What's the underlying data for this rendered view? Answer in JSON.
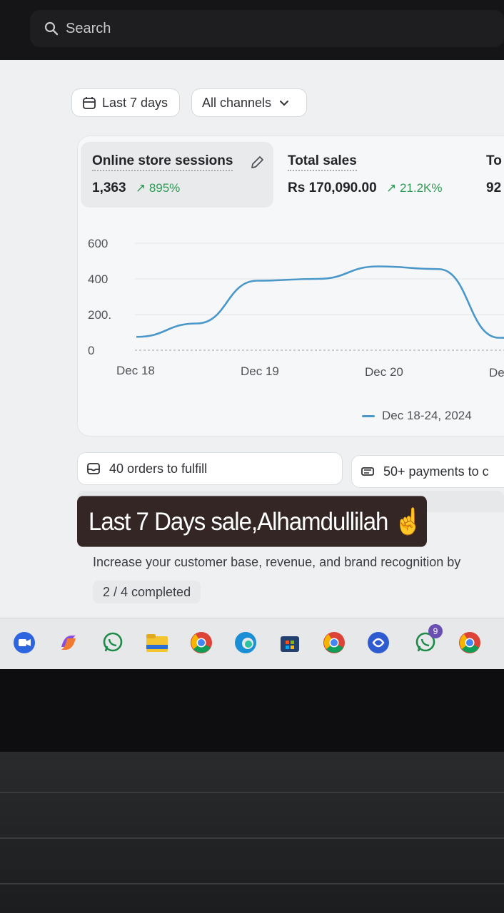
{
  "search": {
    "placeholder": "Search"
  },
  "filters": {
    "date_range": "Last 7 days",
    "channels": "All channels"
  },
  "metrics": [
    {
      "title": "Online store sessions",
      "value": "1,363",
      "change": "895%"
    },
    {
      "title": "Total sales",
      "value": "Rs 170,090.00",
      "change": "21.2K%"
    },
    {
      "title": "To",
      "value": "92"
    }
  ],
  "chart_data": {
    "type": "line",
    "title": "",
    "xlabel": "",
    "ylabel": "",
    "ylim": [
      0,
      600
    ],
    "y_ticks": [
      "600",
      "400",
      "200.",
      "0"
    ],
    "x_ticks": [
      "Dec 18",
      "Dec 19",
      "Dec 20",
      "De"
    ],
    "series": [
      {
        "name": "Dec 18-24, 2024",
        "color": "#4a97c9",
        "x": [
          "Dec 18",
          "Dec 18.5",
          "Dec 19",
          "Dec 19.5",
          "Dec 20",
          "Dec 20.5",
          "Dec 21"
        ],
        "values": [
          75,
          150,
          390,
          400,
          470,
          455,
          70
        ]
      }
    ],
    "grid": true,
    "legend": "bottom-right"
  },
  "tasks": {
    "orders": "40 orders to fulfill",
    "payments": "50+ payments to c"
  },
  "overlay_caption": "Last 7 Days sale,Alhamdullilah ☝️",
  "promo": {
    "description": "Increase your customer base, revenue, and brand recognition by",
    "progress": "2 / 4 completed"
  },
  "taskbar": {
    "whatsapp_badge": "9"
  }
}
